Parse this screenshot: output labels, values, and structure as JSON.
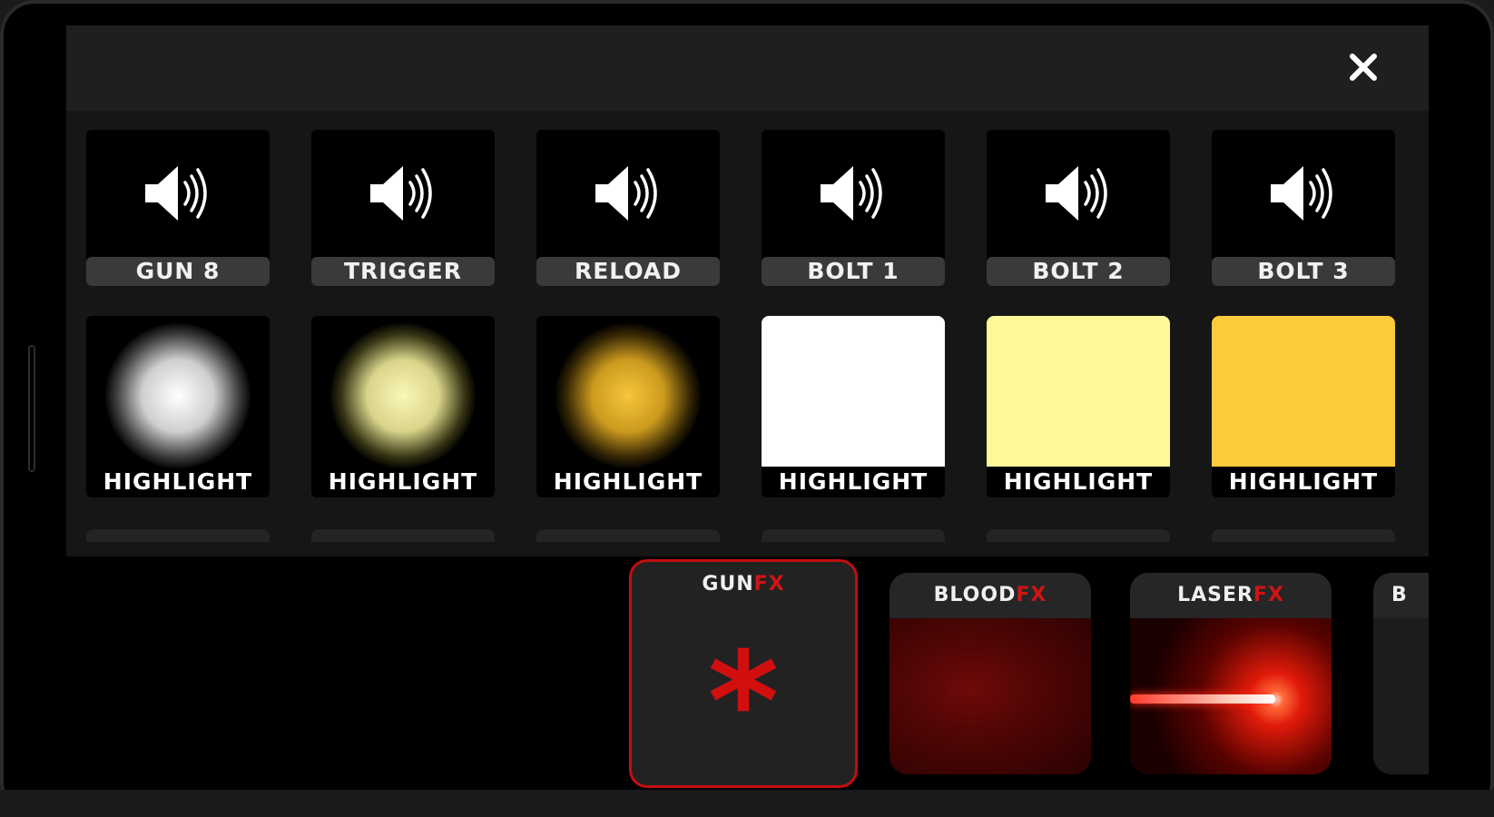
{
  "sound_effects": [
    {
      "label": "GUN 8"
    },
    {
      "label": "TRIGGER"
    },
    {
      "label": "RELOAD"
    },
    {
      "label": "BOLT 1"
    },
    {
      "label": "BOLT 2"
    },
    {
      "label": "BOLT 3"
    }
  ],
  "highlights": [
    {
      "label": "HIGHLIGHT",
      "style": "glow",
      "color": "#ffffff"
    },
    {
      "label": "HIGHLIGHT",
      "style": "glow",
      "color": "#f3f0a0"
    },
    {
      "label": "HIGHLIGHT",
      "style": "glow",
      "color": "#f2b92a"
    },
    {
      "label": "HIGHLIGHT",
      "style": "solid",
      "color": "#ffffff"
    },
    {
      "label": "HIGHLIGHT",
      "style": "solid",
      "color": "#fdf89a"
    },
    {
      "label": "HIGHLIGHT",
      "style": "solid",
      "color": "#fdca3c"
    }
  ],
  "fx_categories": [
    {
      "name": "GUN",
      "suffix": "FX",
      "selected": true,
      "icon": "asterisk-icon"
    },
    {
      "name": "BLOOD",
      "suffix": "FX",
      "selected": false
    },
    {
      "name": "LASER",
      "suffix": "FX",
      "selected": false
    },
    {
      "name": "B",
      "suffix": "",
      "selected": false
    }
  ],
  "icons": {
    "close": "close-icon",
    "sound": "speaker-icon"
  },
  "colors": {
    "accent": "#d11414",
    "panel": "#161616",
    "header": "#1f1f1f",
    "label_bg": "#3a3a3a"
  }
}
